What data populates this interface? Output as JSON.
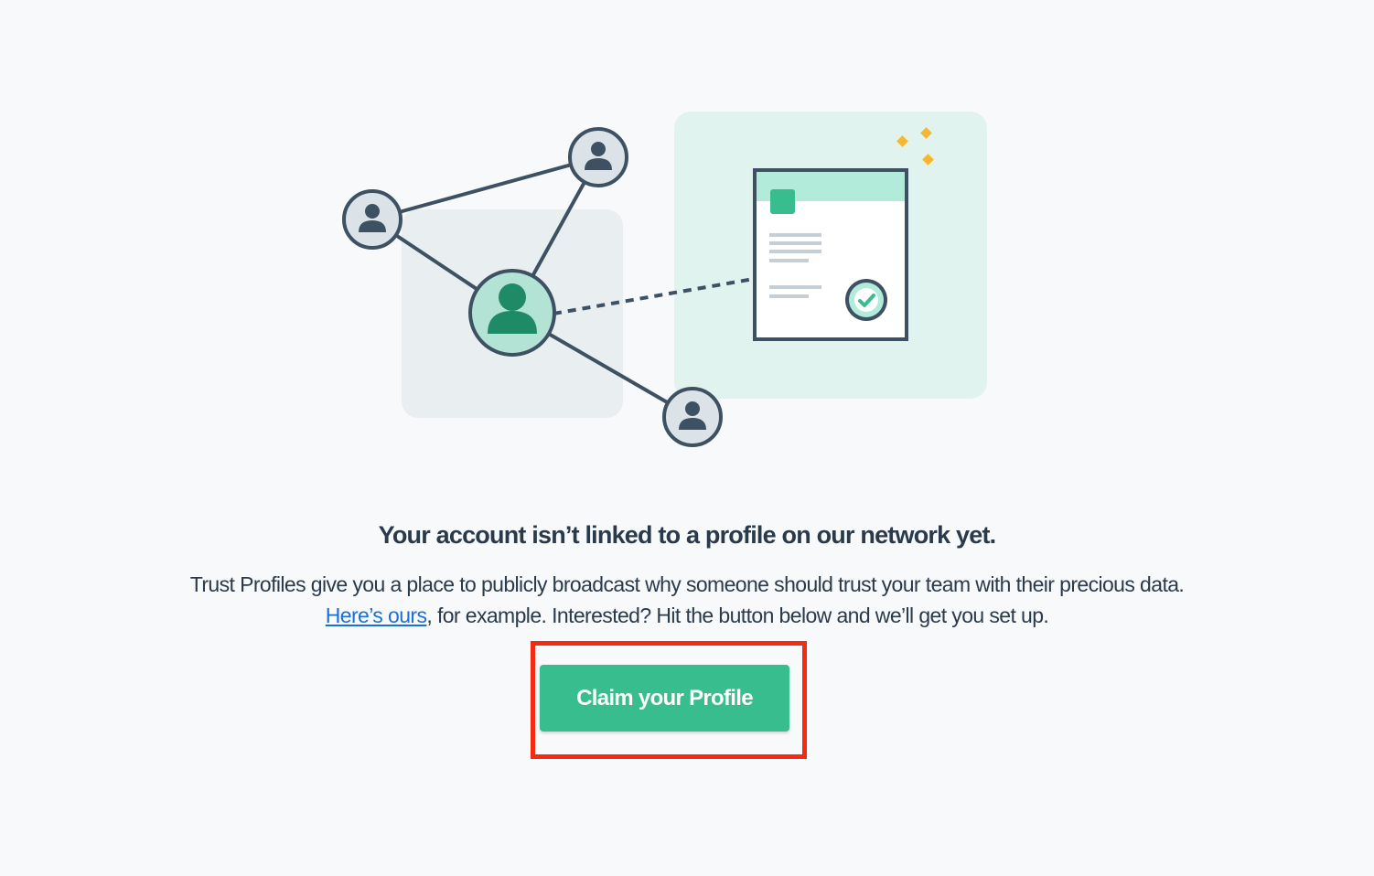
{
  "colors": {
    "background": "#f7f9fb",
    "accent": "#38bd8f",
    "text": "#2b3a4a",
    "link": "#1a6fdb",
    "highlight": "#f42a12"
  },
  "illustration": {
    "icons": [
      "network-graph",
      "user-avatar-icon",
      "document-card",
      "checkmark-icon",
      "sparkle-icon"
    ]
  },
  "message": {
    "headline": "Your account isn’t linked to a profile on our network yet.",
    "body_line1": "Trust Profiles give you a place to publicly broadcast why someone should trust your team with their precious data.",
    "link_text": "Here’s ours",
    "body_line2_rest": ", for example. Interested? Hit the button below and we’ll get you set up."
  },
  "cta": {
    "label": "Claim your Profile"
  }
}
